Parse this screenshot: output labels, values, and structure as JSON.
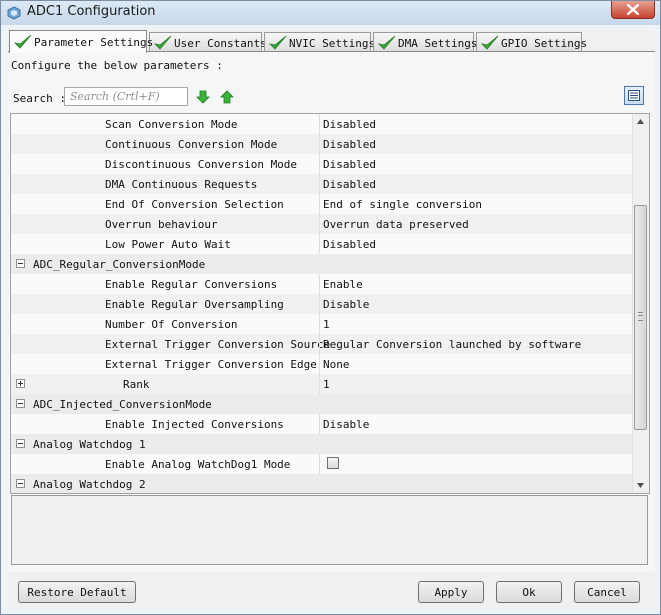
{
  "window": {
    "title": "ADC1 Configuration"
  },
  "tabs": [
    {
      "label": "Parameter Settings",
      "active": true
    },
    {
      "label": "User Constants"
    },
    {
      "label": "NVIC Settings"
    },
    {
      "label": "DMA Settings"
    },
    {
      "label": "GPIO Settings"
    }
  ],
  "panel": {
    "configure_text": "Configure the below parameters :"
  },
  "search": {
    "label": "Search :",
    "placeholder": "Search (Crtl+F)"
  },
  "params": {
    "scan": {
      "name": "Scan Conversion Mode",
      "value": "Disabled"
    },
    "continuous": {
      "name": "Continuous Conversion Mode",
      "value": "Disabled"
    },
    "discontinuous": {
      "name": "Discontinuous Conversion Mode",
      "value": "Disabled"
    },
    "dma_requests": {
      "name": "DMA Continuous Requests",
      "value": "Disabled"
    },
    "eoc": {
      "name": "End Of Conversion Selection",
      "value": "End of single conversion"
    },
    "overrun": {
      "name": "Overrun behaviour",
      "value": "Overrun data preserved"
    },
    "low_power": {
      "name": "Low Power Auto Wait",
      "value": "Disabled"
    },
    "group_regular": {
      "name": "ADC_Regular_ConversionMode"
    },
    "enable_regular": {
      "name": "Enable Regular Conversions",
      "value": "Enable"
    },
    "oversampling": {
      "name": "Enable Regular Oversampling",
      "value": "Disable"
    },
    "num_conv": {
      "name": "Number Of Conversion",
      "value": "1"
    },
    "ext_trig_src": {
      "name": "External Trigger Conversion Source",
      "value": "Regular Conversion launched by software"
    },
    "ext_trig_edge": {
      "name": "External Trigger Conversion Edge",
      "value": "None"
    },
    "rank": {
      "name": "Rank",
      "value": "1"
    },
    "group_injected": {
      "name": "ADC_Injected_ConversionMode"
    },
    "enable_injected": {
      "name": "Enable Injected Conversions",
      "value": "Disable"
    },
    "group_watchdog1": {
      "name": "Analog Watchdog 1"
    },
    "watchdog1_mode": {
      "name": "Enable Analog WatchDog1 Mode",
      "checked": false
    },
    "group_watchdog2": {
      "name": "Analog Watchdog 2"
    }
  },
  "buttons": {
    "restore": "Restore Default",
    "apply": "Apply",
    "ok": "Ok",
    "cancel": "Cancel"
  },
  "colors": {
    "check_green": "#3aa63a",
    "arrow_green": "#3cb23c",
    "view_btn_border": "#4a79b1"
  },
  "icons": {
    "tab_status": "check-icon",
    "search_down": "arrow-down-icon",
    "search_up": "arrow-up-icon",
    "view_toggle": "list-view-icon"
  }
}
